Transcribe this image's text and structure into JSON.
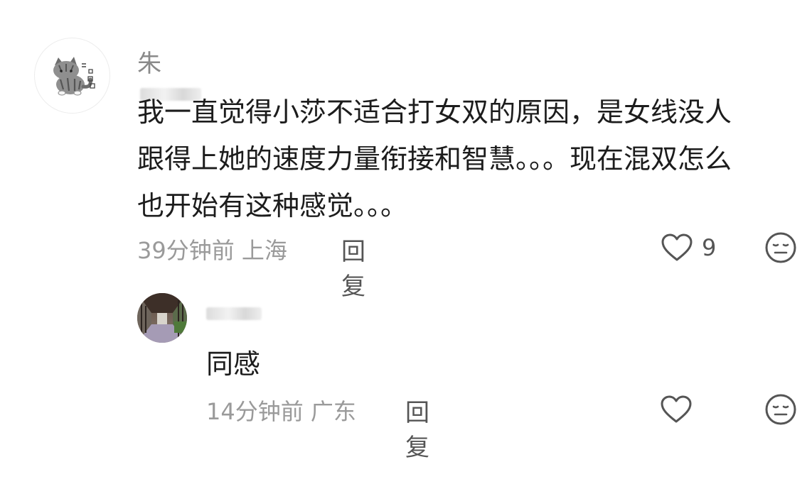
{
  "comments": [
    {
      "username_visible": "朱",
      "text_lines": [
        "我一直觉得小莎不适合打女双的原因，是女线没人",
        "跟得上她的速度力量衔接和智慧。。。现在混双怎么",
        "也开始有这种感觉。。。"
      ],
      "time": "39分钟前",
      "location": "上海",
      "reply_label": "回复",
      "like_count": "9",
      "like_icon": "heart-outline-icon",
      "dislike_icon": "meh-face-icon"
    }
  ],
  "replies": [
    {
      "text": "同感",
      "time": "14分钟前",
      "location": "广东",
      "reply_label": "回复",
      "like_icon": "heart-outline-icon",
      "dislike_icon": "meh-face-icon"
    }
  ],
  "colors": {
    "meta": "#9a9a9a",
    "text": "#1c1c1c",
    "icon": "#555555"
  }
}
